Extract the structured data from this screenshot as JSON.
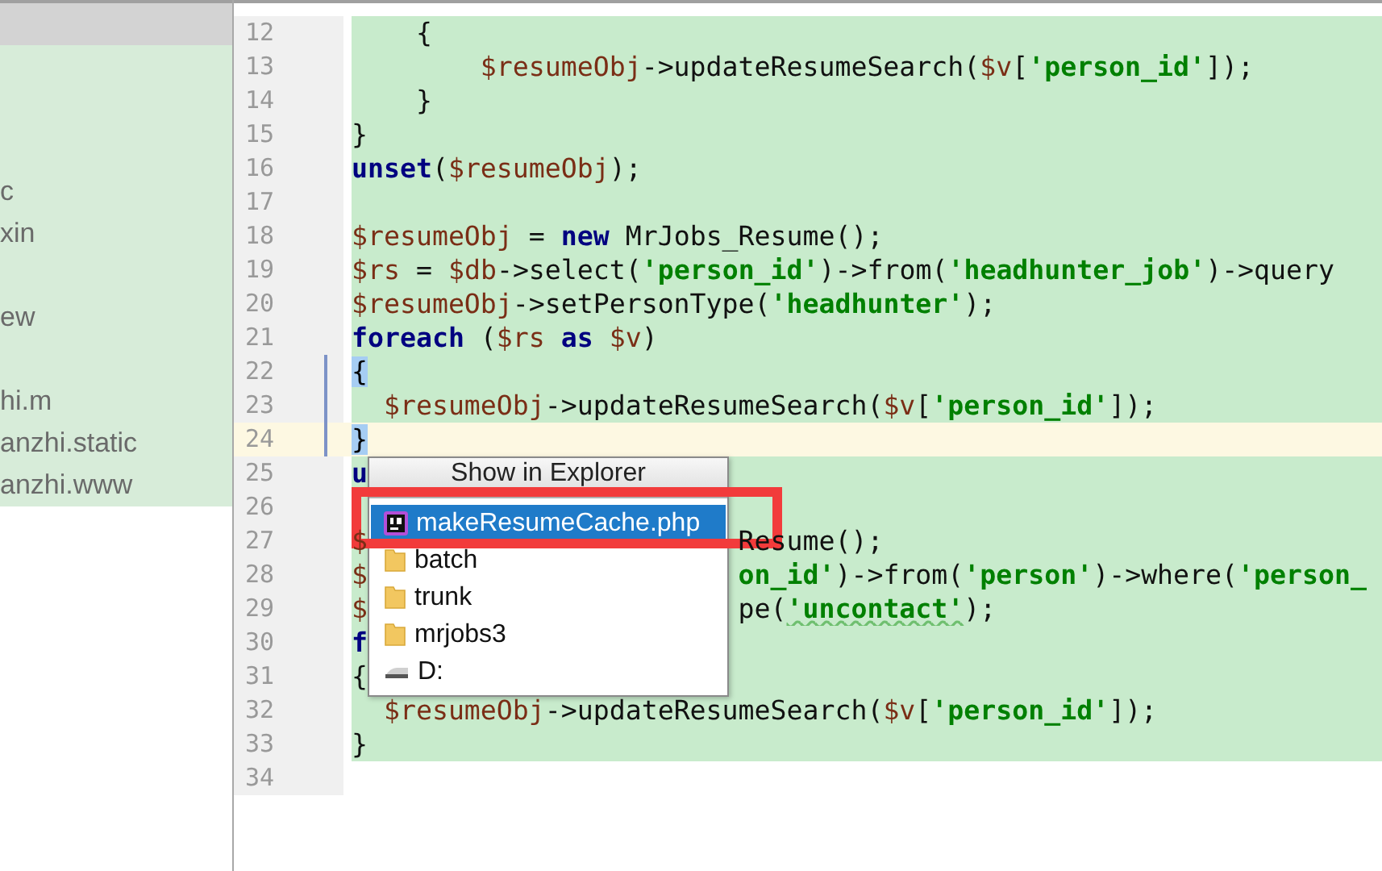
{
  "project_tree": {
    "groups": [
      [
        "c",
        "xin"
      ],
      [
        "ew"
      ],
      [
        "hi.m",
        "anzhi.static",
        "anzhi.www"
      ]
    ]
  },
  "editor": {
    "lines": [
      {
        "number": "12",
        "highlighted": true,
        "current": false,
        "marked": false,
        "tokens": [
          {
            "kind": "plain",
            "text": "    {"
          }
        ]
      },
      {
        "number": "13",
        "highlighted": true,
        "current": false,
        "marked": false,
        "tokens": [
          {
            "kind": "var",
            "text": "        $resumeObj"
          },
          {
            "kind": "plain",
            "text": "->updateResumeSearch("
          },
          {
            "kind": "var",
            "text": "$v"
          },
          {
            "kind": "plain",
            "text": "["
          },
          {
            "kind": "str",
            "text": "'person_id'"
          },
          {
            "kind": "plain",
            "text": "]);"
          }
        ]
      },
      {
        "number": "14",
        "highlighted": true,
        "current": false,
        "marked": false,
        "tokens": [
          {
            "kind": "plain",
            "text": "    }"
          }
        ]
      },
      {
        "number": "15",
        "highlighted": true,
        "current": false,
        "marked": false,
        "tokens": [
          {
            "kind": "plain",
            "text": "}"
          }
        ]
      },
      {
        "number": "16",
        "highlighted": true,
        "current": false,
        "marked": false,
        "tokens": [
          {
            "kind": "kw",
            "text": "unset"
          },
          {
            "kind": "plain",
            "text": "("
          },
          {
            "kind": "var",
            "text": "$resumeObj"
          },
          {
            "kind": "plain",
            "text": ");"
          }
        ]
      },
      {
        "number": "17",
        "highlighted": true,
        "current": false,
        "marked": false
      },
      {
        "number": "18",
        "highlighted": true,
        "current": false,
        "marked": false,
        "tokens": [
          {
            "kind": "var",
            "text": "$resumeObj"
          },
          {
            "kind": "plain",
            "text": " = "
          },
          {
            "kind": "kw",
            "text": "new"
          },
          {
            "kind": "plain",
            "text": " MrJobs_Resume();"
          }
        ]
      },
      {
        "number": "19",
        "highlighted": true,
        "current": false,
        "marked": false,
        "tokens": [
          {
            "kind": "var",
            "text": "$rs"
          },
          {
            "kind": "plain",
            "text": " = "
          },
          {
            "kind": "var",
            "text": "$db"
          },
          {
            "kind": "plain",
            "text": "->select("
          },
          {
            "kind": "str",
            "text": "'person_id'"
          },
          {
            "kind": "plain",
            "text": ")->from("
          },
          {
            "kind": "str",
            "text": "'headhunter_job'"
          },
          {
            "kind": "plain",
            "text": ")->query"
          }
        ]
      },
      {
        "number": "20",
        "highlighted": true,
        "current": false,
        "marked": false,
        "tokens": [
          {
            "kind": "var",
            "text": "$resumeObj"
          },
          {
            "kind": "plain",
            "text": "->setPersonType("
          },
          {
            "kind": "str",
            "text": "'headhunter'"
          },
          {
            "kind": "plain",
            "text": ");"
          }
        ]
      },
      {
        "number": "21",
        "highlighted": true,
        "current": false,
        "marked": false,
        "tokens": [
          {
            "kind": "kw",
            "text": "foreach"
          },
          {
            "kind": "plain",
            "text": " ("
          },
          {
            "kind": "var",
            "text": "$rs"
          },
          {
            "kind": "kw",
            "text": " as "
          },
          {
            "kind": "var",
            "text": "$v"
          },
          {
            "kind": "plain",
            "text": ")"
          }
        ]
      },
      {
        "number": "22",
        "highlighted": true,
        "current": false,
        "marked": true,
        "tokens": [
          {
            "kind": "brace",
            "text": "{"
          }
        ]
      },
      {
        "number": "23",
        "highlighted": true,
        "current": false,
        "marked": true,
        "tokens": [
          {
            "kind": "var",
            "text": "  $resumeObj"
          },
          {
            "kind": "plain",
            "text": "->updateResumeSearch("
          },
          {
            "kind": "var",
            "text": "$v"
          },
          {
            "kind": "plain",
            "text": "["
          },
          {
            "kind": "str",
            "text": "'person_id'"
          },
          {
            "kind": "plain",
            "text": "]);"
          }
        ]
      },
      {
        "number": "24",
        "highlighted": false,
        "current": true,
        "marked": true,
        "tokens": [
          {
            "kind": "brace",
            "text": "}"
          }
        ]
      },
      {
        "number": "25",
        "highlighted": true,
        "current": false,
        "marked": false,
        "tokens": [
          {
            "kind": "kw",
            "text": "u"
          }
        ]
      },
      {
        "number": "26",
        "highlighted": true,
        "current": false,
        "marked": false
      },
      {
        "number": "27",
        "highlighted": true,
        "current": false,
        "marked": false,
        "tokens": [
          {
            "kind": "var",
            "text": "$"
          }
        ],
        "tail": [
          {
            "kind": "plain",
            "text": "Resume();"
          }
        ]
      },
      {
        "number": "28",
        "highlighted": true,
        "current": false,
        "marked": false,
        "tokens": [
          {
            "kind": "var",
            "text": "$"
          }
        ],
        "tail": [
          {
            "kind": "str",
            "text": "on_id'"
          },
          {
            "kind": "plain",
            "text": ")->from("
          },
          {
            "kind": "str",
            "text": "'person'"
          },
          {
            "kind": "plain",
            "text": ")->where("
          },
          {
            "kind": "str",
            "text": "'person_"
          }
        ]
      },
      {
        "number": "29",
        "highlighted": true,
        "current": false,
        "marked": false,
        "tokens": [
          {
            "kind": "var",
            "text": "$"
          }
        ],
        "tail": [
          {
            "kind": "plain",
            "text": "pe("
          },
          {
            "kind": "typo",
            "text": "'uncontact'"
          },
          {
            "kind": "plain",
            "text": ");"
          }
        ]
      },
      {
        "number": "30",
        "highlighted": true,
        "current": false,
        "marked": false,
        "tokens": [
          {
            "kind": "kw",
            "text": "f"
          }
        ]
      },
      {
        "number": "31",
        "highlighted": true,
        "current": false,
        "marked": false,
        "tokens": [
          {
            "kind": "plain",
            "text": "{"
          }
        ]
      },
      {
        "number": "32",
        "highlighted": true,
        "current": false,
        "marked": false,
        "tokens": [
          {
            "kind": "var",
            "text": "  $resumeObj"
          },
          {
            "kind": "plain",
            "text": "->updateResumeSearch("
          },
          {
            "kind": "var",
            "text": "$v"
          },
          {
            "kind": "plain",
            "text": "["
          },
          {
            "kind": "str",
            "text": "'person_id'"
          },
          {
            "kind": "plain",
            "text": "]);"
          }
        ]
      },
      {
        "number": "33",
        "highlighted": true,
        "current": false,
        "marked": false,
        "tokens": [
          {
            "kind": "plain",
            "text": "}"
          }
        ]
      },
      {
        "number": "34",
        "highlighted": false,
        "current": false,
        "marked": false
      }
    ]
  },
  "popup": {
    "title": "Show in Explorer",
    "items": [
      {
        "label": "makeResumeCache.php",
        "kind": "php",
        "selected": true
      },
      {
        "label": "batch",
        "kind": "folder",
        "selected": false
      },
      {
        "label": "trunk",
        "kind": "folder",
        "selected": false
      },
      {
        "label": "mrjobs3",
        "kind": "folder",
        "selected": false
      },
      {
        "label": "D:",
        "kind": "drive",
        "selected": false
      }
    ]
  }
}
